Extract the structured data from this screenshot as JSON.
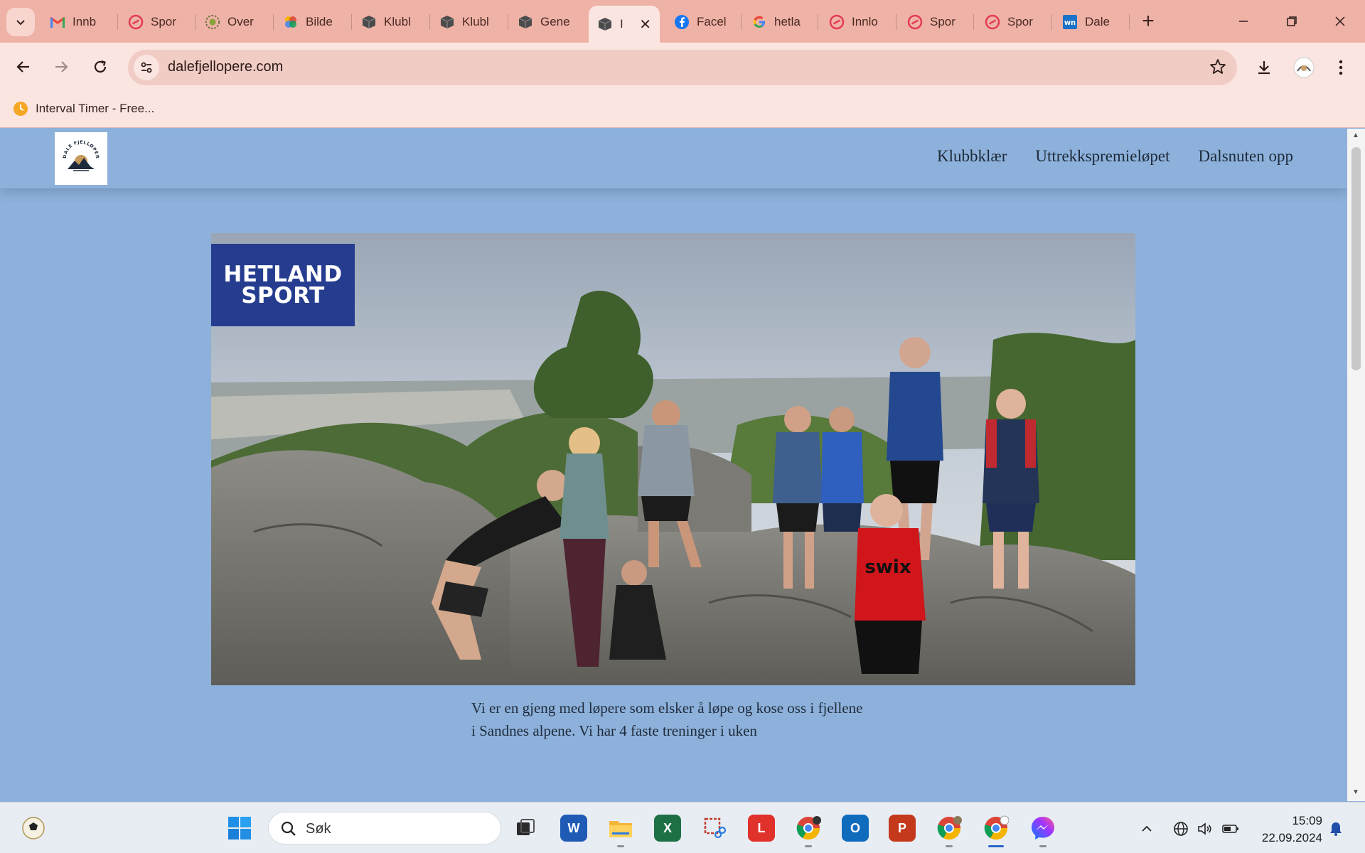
{
  "browser": {
    "tabs": [
      {
        "label": "Innb",
        "icon": "gmail-icon"
      },
      {
        "label": "Spor",
        "icon": "strava-icon"
      },
      {
        "label": "Over",
        "icon": "overview-icon"
      },
      {
        "label": "Bilde",
        "icon": "photos-icon"
      },
      {
        "label": "Klubl",
        "icon": "cube-icon"
      },
      {
        "label": "Klubl",
        "icon": "cube-icon"
      },
      {
        "label": "Gene",
        "icon": "cube-icon"
      },
      {
        "label": "I",
        "icon": "cube-icon",
        "active": true
      },
      {
        "label": "Facel",
        "icon": "facebook-icon"
      },
      {
        "label": "hetla",
        "icon": "google-icon"
      },
      {
        "label": "Innlo",
        "icon": "strava-icon"
      },
      {
        "label": "Spor",
        "icon": "strava-icon"
      },
      {
        "label": "Spor",
        "icon": "strava-icon"
      },
      {
        "label": "Dale",
        "icon": "webnode-icon"
      }
    ],
    "url": "dalefjellopere.com",
    "bookmark": "Interval Timer - Free..."
  },
  "site": {
    "menu": [
      "Klubbklær",
      "Uttrekkspremieløpet",
      "Dalsnuten opp"
    ],
    "sponsor_line1": "HETLAND",
    "sponsor_line2": "SPORT",
    "intro": "Vi er en gjeng med løpere som elsker å løpe og kose oss i fjellene i Sandnes alpene. Vi har 4 faste treninger i uken"
  },
  "taskbar": {
    "search": "Søk",
    "time": "15:09",
    "date": "22.09.2024"
  },
  "colors": {
    "tabstrip": "#efb2a6",
    "toolbar": "#fbe5e1",
    "page_bg": "#8db1da",
    "sponsor_blue": "#263d8f"
  }
}
